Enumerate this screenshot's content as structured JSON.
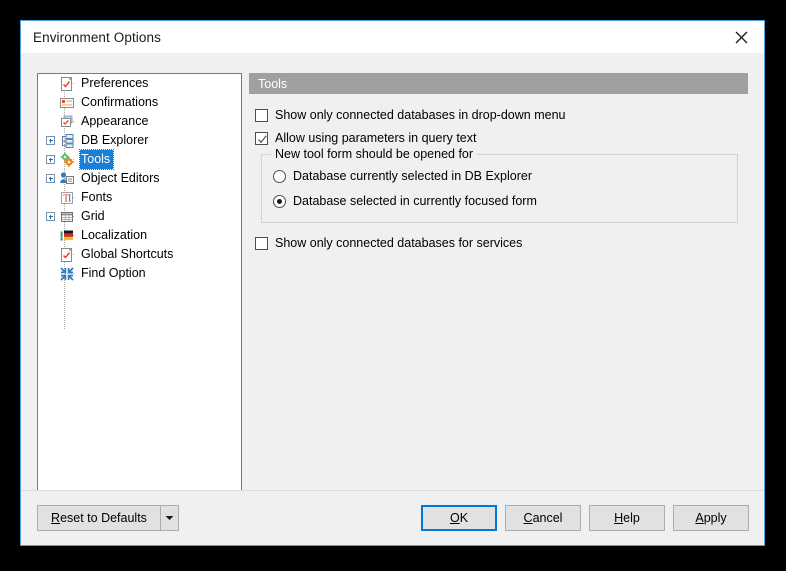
{
  "window": {
    "title": "Environment Options",
    "close_icon": "close-icon"
  },
  "tree": {
    "items": [
      {
        "label": "Preferences",
        "icon": "preferences-icon",
        "expandable": false,
        "selected": false
      },
      {
        "label": "Confirmations",
        "icon": "confirmations-icon",
        "expandable": false,
        "selected": false
      },
      {
        "label": "Appearance",
        "icon": "appearance-icon",
        "expandable": false,
        "selected": false
      },
      {
        "label": "DB Explorer",
        "icon": "db-explorer-icon",
        "expandable": true,
        "selected": false
      },
      {
        "label": "Tools",
        "icon": "tools-icon",
        "expandable": true,
        "selected": true
      },
      {
        "label": "Object Editors",
        "icon": "object-editors-icon",
        "expandable": true,
        "selected": false
      },
      {
        "label": "Fonts",
        "icon": "fonts-icon",
        "expandable": false,
        "selected": false
      },
      {
        "label": "Grid",
        "icon": "grid-icon",
        "expandable": true,
        "selected": false
      },
      {
        "label": "Localization",
        "icon": "localization-icon",
        "expandable": false,
        "selected": false
      },
      {
        "label": "Global Shortcuts",
        "icon": "global-shortcuts-icon",
        "expandable": false,
        "selected": false
      },
      {
        "label": "Find Option",
        "icon": "find-option-icon",
        "expandable": false,
        "selected": false
      }
    ]
  },
  "panel": {
    "header": "Tools",
    "checkbox_dropdown": {
      "label": "Show only connected databases in drop-down menu",
      "checked": false
    },
    "checkbox_parameters": {
      "label": "Allow using parameters in query text",
      "checked": true
    },
    "group": {
      "legend": "New tool form should be opened for",
      "options": [
        {
          "label": "Database currently selected in DB Explorer",
          "selected": false
        },
        {
          "label": "Database selected in currently focused form",
          "selected": true
        }
      ]
    },
    "checkbox_services": {
      "label": "Show only connected databases for services",
      "checked": false
    }
  },
  "footer": {
    "reset": {
      "accel": "R",
      "rest": "eset to Defaults"
    },
    "reset_dropdown_icon": "chevron-down-icon",
    "ok": {
      "accel": "O",
      "rest": "K"
    },
    "cancel": {
      "accel": "C",
      "rest": "ancel"
    },
    "help": {
      "accel": "H",
      "rest": "elp"
    },
    "apply": {
      "accel": "A",
      "rest": "pply"
    }
  },
  "colors": {
    "selection_blue": "#1c7fd6",
    "focus_blue": "#0078d7",
    "window_border": "#4aa3e0",
    "panel_header_gray": "#a0a0a0",
    "dialog_bg": "#f0f0f0"
  }
}
